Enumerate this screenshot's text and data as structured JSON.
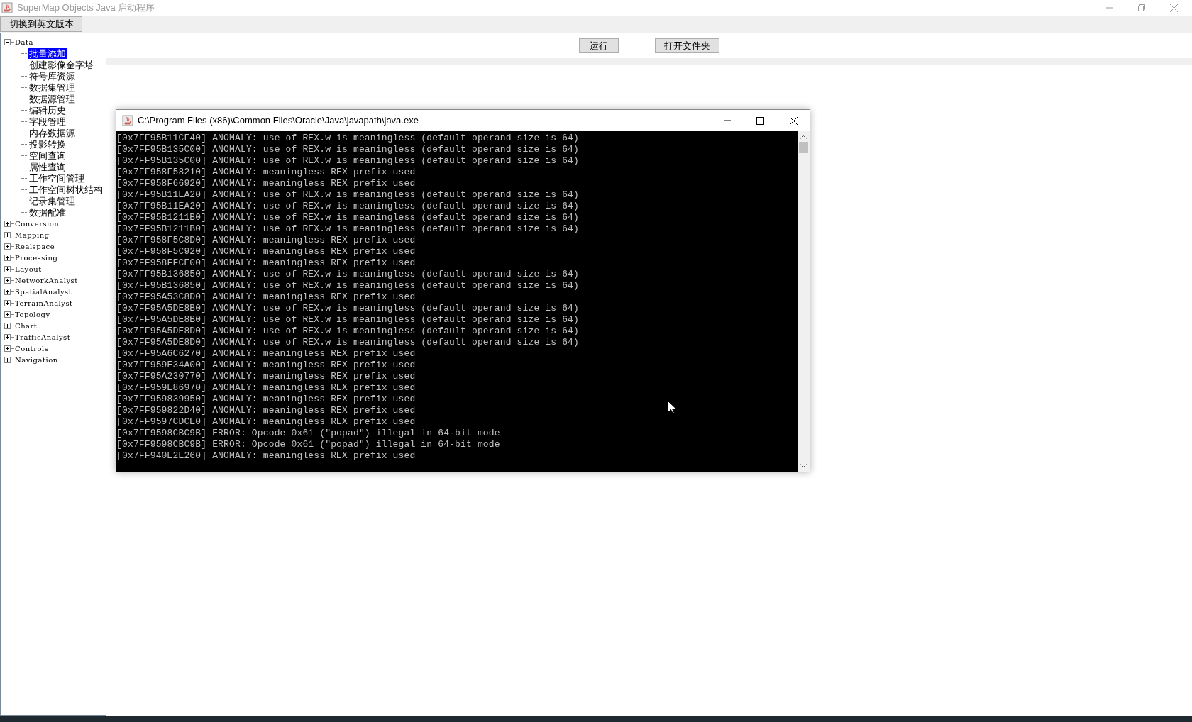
{
  "window": {
    "title": "SuperMap Objects Java 启动程序"
  },
  "toolbar": {
    "button": "切换到英文版本"
  },
  "tree": [
    {
      "label": "Data",
      "expanded": true,
      "children": [
        {
          "label": "批量添加",
          "selected": true
        },
        {
          "label": "创建影像金字塔",
          "selected": false
        },
        {
          "label": "符号库资源",
          "selected": false
        },
        {
          "label": "数据集管理",
          "selected": false
        },
        {
          "label": "数据源管理",
          "selected": false
        },
        {
          "label": "编辑历史",
          "selected": false
        },
        {
          "label": "字段管理",
          "selected": false
        },
        {
          "label": "内存数据源",
          "selected": false
        },
        {
          "label": "投影转换",
          "selected": false
        },
        {
          "label": "空间查询",
          "selected": false
        },
        {
          "label": "属性查询",
          "selected": false
        },
        {
          "label": "工作空间管理",
          "selected": false
        },
        {
          "label": "工作空间树状结构",
          "selected": false
        },
        {
          "label": "记录集管理",
          "selected": false
        },
        {
          "label": "数据配准",
          "selected": false
        }
      ]
    },
    {
      "label": "Conversion",
      "expanded": false
    },
    {
      "label": "Mapping",
      "expanded": false
    },
    {
      "label": "Realspace",
      "expanded": false
    },
    {
      "label": "Processing",
      "expanded": false
    },
    {
      "label": "Layout",
      "expanded": false
    },
    {
      "label": "NetworkAnalyst",
      "expanded": false
    },
    {
      "label": "SpatialAnalyst",
      "expanded": false
    },
    {
      "label": "TerrainAnalyst",
      "expanded": false
    },
    {
      "label": "Topology",
      "expanded": false
    },
    {
      "label": "Chart",
      "expanded": false
    },
    {
      "label": "TrafficAnalyst",
      "expanded": false
    },
    {
      "label": "Controls",
      "expanded": false
    },
    {
      "label": "Navigation",
      "expanded": false
    }
  ],
  "actions": [
    "运行",
    "打开文件夹"
  ],
  "console": {
    "title": "C:\\Program Files (x86)\\Common Files\\Oracle\\Java\\javapath\\java.exe",
    "lines": [
      "[0x7FF95B11CF40] ANOMALY: use of REX.w is meaningless (default operand size is 64)",
      "[0x7FF95B135C00] ANOMALY: use of REX.w is meaningless (default operand size is 64)",
      "[0x7FF95B135C00] ANOMALY: use of REX.w is meaningless (default operand size is 64)",
      "[0x7FF958F58210] ANOMALY: meaningless REX prefix used",
      "[0x7FF958F66920] ANOMALY: meaningless REX prefix used",
      "[0x7FF95B11EA20] ANOMALY: use of REX.w is meaningless (default operand size is 64)",
      "[0x7FF95B11EA20] ANOMALY: use of REX.w is meaningless (default operand size is 64)",
      "[0x7FF95B1211B0] ANOMALY: use of REX.w is meaningless (default operand size is 64)",
      "[0x7FF95B1211B0] ANOMALY: use of REX.w is meaningless (default operand size is 64)",
      "[0x7FF958F5C8D0] ANOMALY: meaningless REX prefix used",
      "[0x7FF958F5C920] ANOMALY: meaningless REX prefix used",
      "[0x7FF958FFCE00] ANOMALY: meaningless REX prefix used",
      "[0x7FF95B136850] ANOMALY: use of REX.w is meaningless (default operand size is 64)",
      "[0x7FF95B136850] ANOMALY: use of REX.w is meaningless (default operand size is 64)",
      "[0x7FF95A53C8D0] ANOMALY: meaningless REX prefix used",
      "[0x7FF95A5DE8B0] ANOMALY: use of REX.w is meaningless (default operand size is 64)",
      "[0x7FF95A5DE8B0] ANOMALY: use of REX.w is meaningless (default operand size is 64)",
      "[0x7FF95A5DE8D0] ANOMALY: use of REX.w is meaningless (default operand size is 64)",
      "[0x7FF95A5DE8D0] ANOMALY: use of REX.w is meaningless (default operand size is 64)",
      "[0x7FF95A6C6270] ANOMALY: meaningless REX prefix used",
      "[0x7FF959E34A00] ANOMALY: meaningless REX prefix used",
      "[0x7FF95A230770] ANOMALY: meaningless REX prefix used",
      "[0x7FF959E86970] ANOMALY: meaningless REX prefix used",
      "[0x7FF959839950] ANOMALY: meaningless REX prefix used",
      "[0x7FF959822D40] ANOMALY: meaningless REX prefix used",
      "[0x7FF9597CDCE0] ANOMALY: meaningless REX prefix used",
      "[0x7FF9598CBC9B] ERROR: Opcode 0x61 (\"popad\") illegal in 64-bit mode",
      "[0x7FF9598CBC9B] ERROR: Opcode 0x61 (\"popad\") illegal in 64-bit mode",
      "[0x7FF940E2E260] ANOMALY: meaningless REX prefix used"
    ]
  }
}
